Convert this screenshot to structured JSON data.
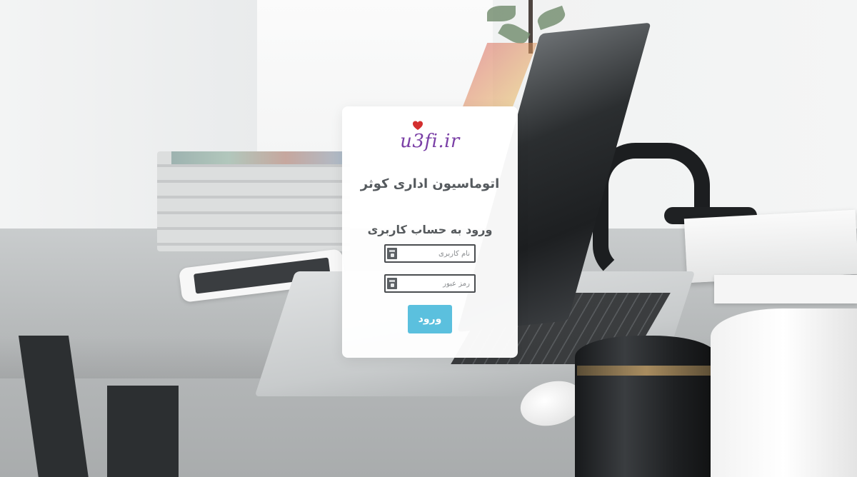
{
  "logo": {
    "text": "u3fi.ir",
    "heart_color": "#d32f2f",
    "text_color": "#7a3fa6"
  },
  "login": {
    "system_title": "اتوماسیون اداری کوثر",
    "subtitle": "ورود به حساب کاربری",
    "username": {
      "placeholder": "نام کاربری",
      "value": "",
      "icon": "id-card-icon"
    },
    "password": {
      "placeholder": "رمز عبور",
      "value": "",
      "icon": "id-card-icon"
    },
    "submit_label": "ورود",
    "accent_color": "#5bc0de"
  }
}
